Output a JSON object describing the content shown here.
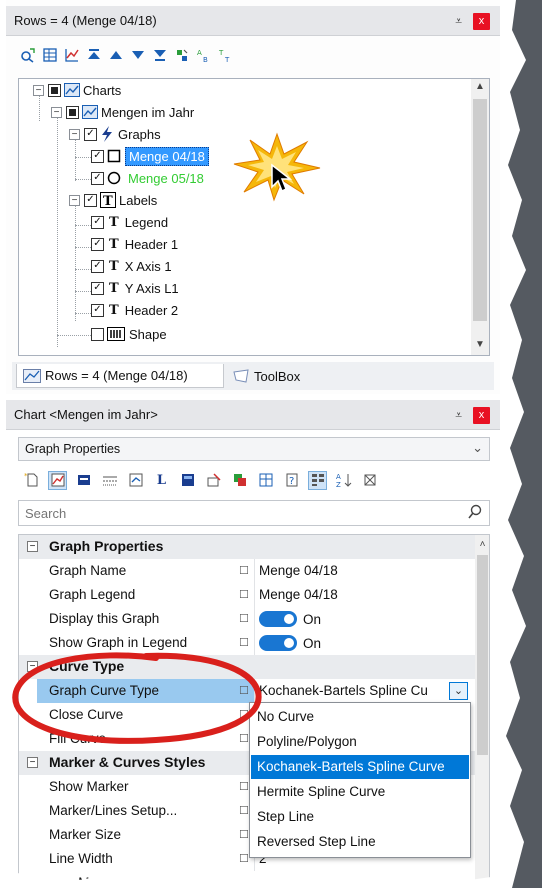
{
  "top_panel": {
    "title": "Rows = 4 (Menge 04/18)",
    "pin_glyph": "📌",
    "close_glyph": "x",
    "toolbar_icons": [
      "find-replace-icon",
      "table-icon",
      "chart-icon",
      "move-top-icon",
      "move-up-icon",
      "move-down-icon",
      "move-bottom-icon",
      "sort-icon",
      "rename-icon",
      "rename-all-icon"
    ]
  },
  "tree": {
    "items": [
      {
        "label": "Charts",
        "expander": "−"
      },
      {
        "label": "Mengen im Jahr",
        "expander": "−"
      },
      {
        "label": "Graphs",
        "expander": "−"
      },
      {
        "label": "Menge 04/18",
        "selected": true
      },
      {
        "label": "Menge 05/18",
        "color": "#33cc33"
      },
      {
        "label": "Labels",
        "expander": "−"
      },
      {
        "label": "Legend"
      },
      {
        "label": "Header 1"
      },
      {
        "label": "X Axis 1"
      },
      {
        "label": "Y Axis L1"
      },
      {
        "label": "Header 2"
      },
      {
        "label": "Shape"
      }
    ]
  },
  "tabs": [
    {
      "label": "Rows = 4 (Menge 04/18)",
      "active": true
    },
    {
      "label": "ToolBox",
      "active": false
    }
  ],
  "bottom_panel": {
    "title": "Chart <Mengen im Jahr>",
    "pin_glyph": "📌",
    "close_glyph": "x",
    "selector_value": "Graph Properties",
    "toolbar_icons": [
      "new-icon",
      "properties-icon",
      "graph-icon",
      "lines-icon",
      "settings-icon",
      "label-icon",
      "color-icon",
      "fill-icon",
      "layers-icon",
      "table-icon",
      "help-icon",
      "categorized-icon",
      "sort-alpha-icon",
      "collapse-icon"
    ],
    "search_placeholder": "Search"
  },
  "grid": {
    "sections": [
      {
        "title": "Graph Properties",
        "rows": [
          {
            "name": "Graph Name",
            "value": "Menge 04/18"
          },
          {
            "name": "Graph Legend",
            "value": "Menge 04/18"
          },
          {
            "name": "Display this Graph",
            "value": "On",
            "toggle": true
          },
          {
            "name": "Show Graph in Legend",
            "value": "On",
            "toggle": true
          }
        ]
      },
      {
        "title": "Curve Type",
        "rows": [
          {
            "name": "Graph Curve Type",
            "value": "Kochanek-Bartels Spline Cu",
            "selected": true
          },
          {
            "name": "Close Curve",
            "value": ""
          },
          {
            "name": "Fill Curve",
            "value": ""
          }
        ]
      },
      {
        "title": "Marker & Curves Styles",
        "rows": [
          {
            "name": "Show Marker",
            "value": ""
          },
          {
            "name": "Marker/Lines Setup...",
            "value": ""
          },
          {
            "name": "Marker Size",
            "value": ""
          },
          {
            "name": "Line Width",
            "value": "2"
          },
          {
            "name": "Line Mode",
            "value": ""
          }
        ]
      }
    ],
    "edit_glyph": "☐"
  },
  "dropdown": {
    "options": [
      "No Curve",
      "Polyline/Polygon",
      "Kochanek-Bartels Spline Curve",
      "Hermite Spline Curve",
      "Step Line",
      "Reversed Step Line"
    ],
    "selected_index": 2
  },
  "annotation": {
    "circle_color": "#d9201c",
    "burst_color": "#f5b70a"
  },
  "colors": {
    "selection_blue": "#0078d7",
    "tree_selection": "#3399ff",
    "row_highlight": "#cce8ff",
    "toggle_blue": "#1976d2"
  }
}
